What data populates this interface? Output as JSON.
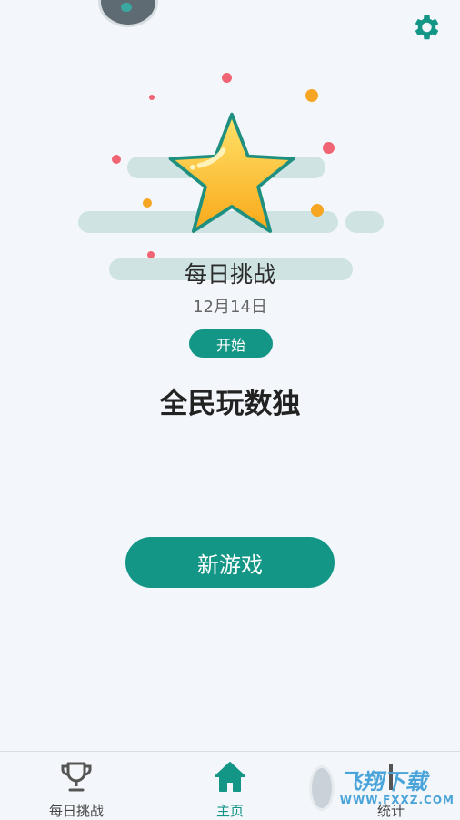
{
  "header": {
    "avatar": "avatar-icon",
    "settings_icon": "gear-icon"
  },
  "daily": {
    "title": "每日挑战",
    "date": "12月14日",
    "start_label": "开始"
  },
  "app_name": "全民玩数独",
  "new_game_label": "新游戏",
  "tabs": [
    {
      "label": "每日挑战",
      "icon": "trophy-icon",
      "active": false
    },
    {
      "label": "主页",
      "icon": "home-icon",
      "active": true
    },
    {
      "label": "统计",
      "icon": "stats-icon",
      "active": false
    }
  ],
  "watermark": {
    "main": "飞翔下载",
    "sub": "WWW.FXXZ.COM"
  },
  "colors": {
    "accent": "#149686",
    "background": "#f3f7fb",
    "star": "#f9b51d",
    "cloud": "#cfe3e3"
  }
}
